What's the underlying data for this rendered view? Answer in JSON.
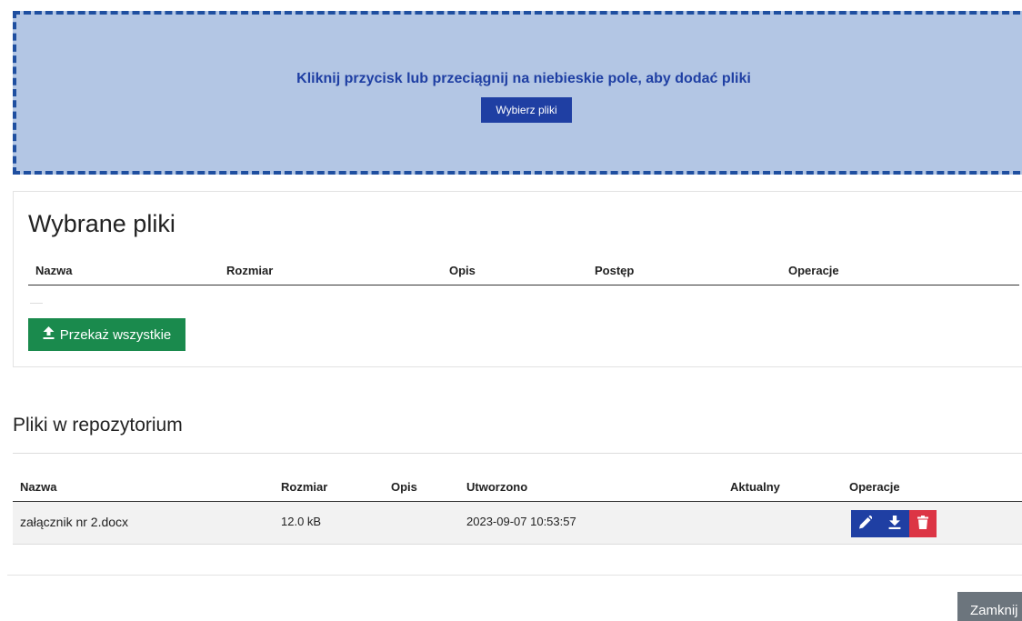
{
  "dropzone": {
    "instruction": "Kliknij przycisk lub przeciągnij na niebieskie pole, aby dodać pliki",
    "choose_label": "Wybierz pliki",
    "background_color": "#b3c6e4",
    "border_color": "#1f4fa0"
  },
  "selected": {
    "title": "Wybrane pliki",
    "columns": [
      "Nazwa",
      "Rozmiar",
      "Opis",
      "Postęp",
      "Operacje"
    ],
    "rows": [],
    "upload_all_label": "Przekaż wszystkie",
    "upload_icon": "upload-icon"
  },
  "repository": {
    "title": "Pliki w repozytorium",
    "columns": [
      "Nazwa",
      "Rozmiar",
      "Opis",
      "Utworzono",
      "Aktualny",
      "Operacje"
    ],
    "rows": [
      {
        "name": "załącznik nr 2.docx",
        "size": "12.0 kB",
        "description": "",
        "created": "2023-09-07 10:53:57",
        "current": "",
        "operations": [
          "edit-icon",
          "download-icon",
          "delete-icon"
        ]
      }
    ]
  },
  "footer": {
    "close_label": "Zamknij"
  },
  "colors": {
    "primary": "#1f3fa3",
    "success": "#1a8a4d",
    "danger": "#dc3545",
    "secondary": "#6c757d"
  }
}
